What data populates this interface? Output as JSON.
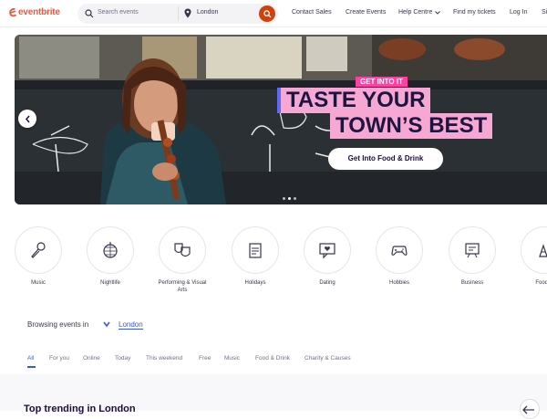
{
  "header": {
    "logo_text": "eventbrite",
    "search": {
      "placeholder": "Search events",
      "location": "London"
    },
    "nav": [
      "Contact Sales",
      "Create Events",
      "Help Centre",
      "Find my tickets",
      "Log In",
      "Si"
    ]
  },
  "hero": {
    "kicker": "GET INTO IT",
    "headline_line1": "TASTE YOUR",
    "headline_line2": "TOWN’S BEST",
    "cta_label": "Get Into Food & Drink",
    "slide_dots": 3,
    "active_slide": 2
  },
  "categories": [
    {
      "label": "Music",
      "icon": "microphone-icon"
    },
    {
      "label": "Nightlife",
      "icon": "disco-ball-icon"
    },
    {
      "label": "Performing & Visual Arts",
      "icon": "theater-masks-icon"
    },
    {
      "label": "Holidays",
      "icon": "calendar-icon"
    },
    {
      "label": "Dating",
      "icon": "chat-heart-icon"
    },
    {
      "label": "Hobbies",
      "icon": "gamepad-icon"
    },
    {
      "label": "Business",
      "icon": "presentation-icon"
    },
    {
      "label": "Food &",
      "icon": "food-icon"
    }
  ],
  "browsing": {
    "label": "Browsing events in",
    "city": "London"
  },
  "tabs": [
    "All",
    "For you",
    "Online",
    "Today",
    "This weekend",
    "Free",
    "Music",
    "Food & Drink",
    "Charity & Causes"
  ],
  "active_tab": "All",
  "section": {
    "title": "Top trending in London"
  },
  "colors": {
    "brand": "#f05537",
    "search_button": "#d1410c",
    "link": "#3659e3",
    "pink": "#f6a7d2",
    "magenta": "#ff3fa4",
    "purple_accent": "#5b6cf7"
  }
}
